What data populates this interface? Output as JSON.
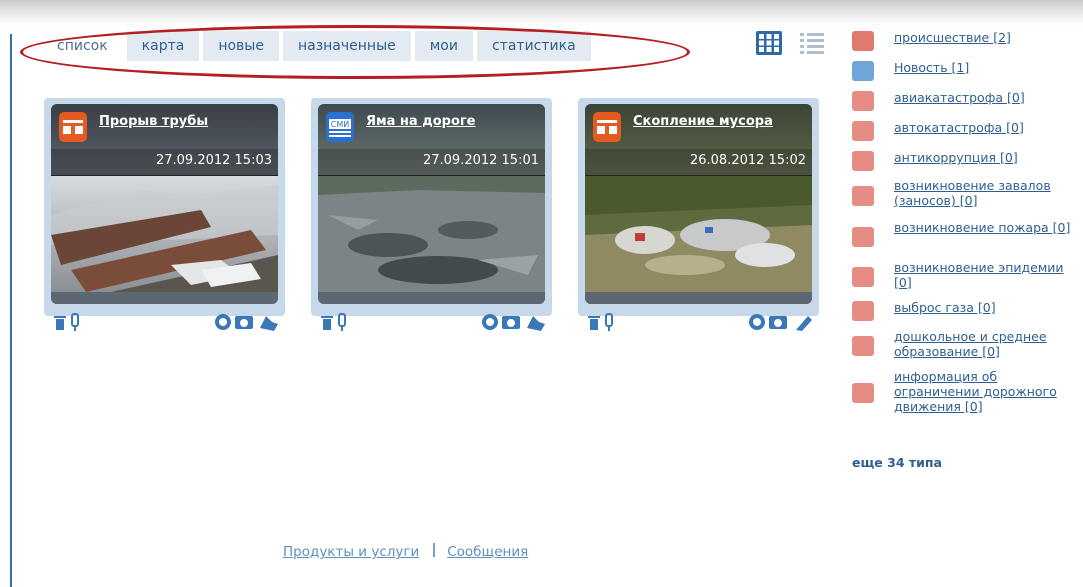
{
  "tabs": [
    {
      "label": "список",
      "active": true
    },
    {
      "label": "карта"
    },
    {
      "label": "новые"
    },
    {
      "label": "назначенные"
    },
    {
      "label": "мои"
    },
    {
      "label": "статистика"
    }
  ],
  "cards": [
    {
      "title": "Прорыв трубы",
      "date": "27.09.2012 15:03",
      "icon": "incident-icon"
    },
    {
      "title": "Яма на дороге",
      "date": "27.09.2012 15:01",
      "icon": "smi-news-icon",
      "icon_text": "СМИ"
    },
    {
      "title": "Скопление мусора",
      "date": "26.08.2012 15:02",
      "icon": "incident-icon"
    }
  ],
  "sidebar": {
    "items": [
      {
        "label": "происшествие [2]",
        "icon": "incident-icon",
        "color": "#e07a6f"
      },
      {
        "label": "Новость [1]",
        "icon": "news-icon",
        "color": "#6ea6d8"
      },
      {
        "label": "авиакатастрофа [0]",
        "icon": "plane-crash-icon",
        "color": "#e58c85"
      },
      {
        "label": "автокатастрофа [0]",
        "icon": "car-crash-icon",
        "color": "#e58c85"
      },
      {
        "label": "антикоррупция [0]",
        "icon": "hammer-icon",
        "color": "#e58c85"
      },
      {
        "label": "возникновение завалов (заносов) [0]",
        "icon": "snow-icon",
        "color": "#e58c85"
      },
      {
        "label": "возникновение пожара [0]",
        "icon": "fire-icon",
        "color": "#e58c85"
      },
      {
        "label": "возникновение эпидемии [0]",
        "icon": "biohazard-icon",
        "color": "#e58c85"
      },
      {
        "label": "выброс газа [0]",
        "icon": "gas-icon",
        "color": "#e58c85"
      },
      {
        "label": "дошкольное и среднее образование [0]",
        "icon": "education-icon",
        "color": "#e58c85"
      },
      {
        "label": "информация об ограничении дорожного движения [0]",
        "icon": "road-warning-icon",
        "color": "#e58c85"
      }
    ],
    "more": "еще 34 типа"
  },
  "footer": {
    "products": "Продукты и услуги",
    "messages": "Сообщения"
  },
  "colors": {
    "link": "#2e5f90",
    "tab_bg": "#e4eaf1",
    "card_frame": "#c6d8ea",
    "ellipse": "#b51f23"
  }
}
